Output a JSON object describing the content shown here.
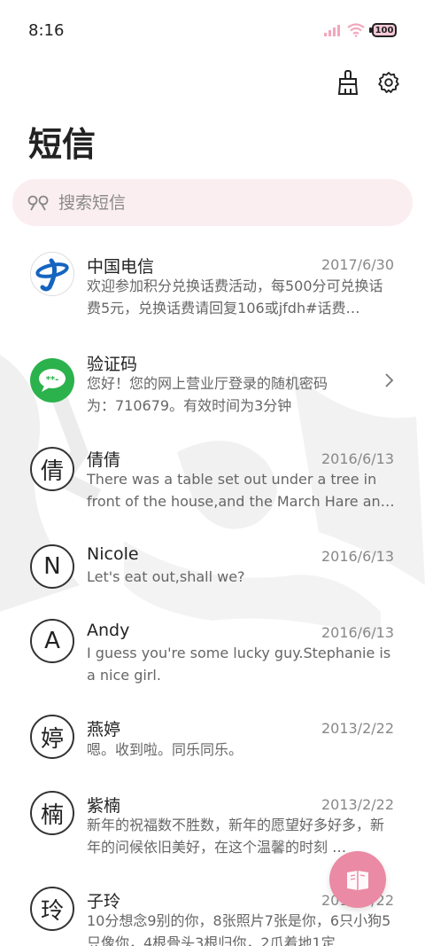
{
  "status_bar": {
    "time": "8:16",
    "battery": "100"
  },
  "page_title": "短信",
  "search": {
    "placeholder": "搜索短信"
  },
  "messages": [
    {
      "sender": "中国电信",
      "date": "2017/6/30",
      "preview": "欢迎参加积分兑换话费活动，每500分可兑换话费5元，兑换话费请回复106或jfdh#话费…",
      "avatar": "telecom-logo"
    },
    {
      "sender": "验证码",
      "date": "",
      "preview": "您好！您的网上营业厅登录的随机密码为：710679。有效时间为3分钟",
      "avatar": "message-bubble"
    },
    {
      "sender": "倩倩",
      "date": "2016/6/13",
      "preview": "There was a table set out under a tree in front of the house,and the March Hare an…",
      "avatar": "倩"
    },
    {
      "sender": "Nicole",
      "date": "2016/6/13",
      "preview": "Let's eat out,shall we?",
      "avatar": "N"
    },
    {
      "sender": "Andy",
      "date": "2016/6/13",
      "preview": "I guess you're some lucky guy.Stephanie is a nice girl.",
      "avatar": "A"
    },
    {
      "sender": "燕婷",
      "date": "2013/2/22",
      "preview": "嗯。收到啦。同乐同乐。",
      "avatar": "婷"
    },
    {
      "sender": "紫楠",
      "date": "2013/2/22",
      "preview": "新年的祝福数不胜数，新年的愿望好多好多，新年的问候依旧美好，在这个温馨的时刻 …",
      "avatar": "楠"
    },
    {
      "sender": "子玲",
      "date": "2013/2/22",
      "preview": "10分想念9别的你，8张照片7张是你，6只小狗5只像你，4根骨头3根归你，2爪着地1定",
      "avatar": "玲"
    }
  ],
  "colors": {
    "accent": "#ea8aa4",
    "search_bg": "#fbeef1",
    "telecom_blue": "#1565c0",
    "sms_green": "#2bb24c"
  },
  "icons": {
    "clean": "broom-icon",
    "settings": "gear-icon",
    "search": "search-icon",
    "compose": "compose-icon"
  }
}
